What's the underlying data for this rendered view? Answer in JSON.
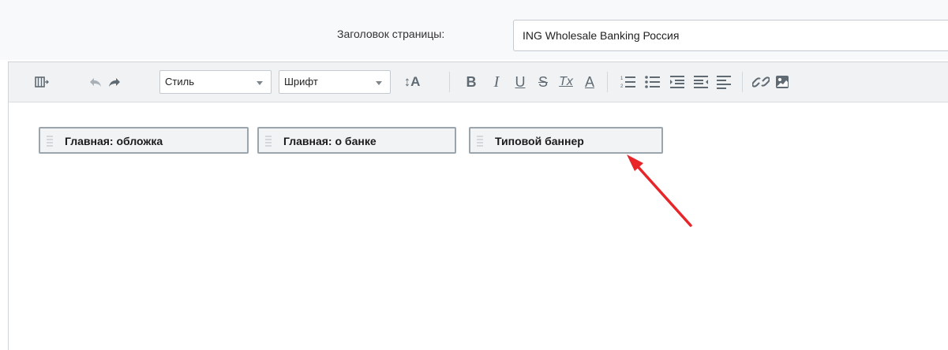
{
  "title_row": {
    "label": "Заголовок страницы:",
    "value": "ING Wholesale Banking Россия"
  },
  "toolbar": {
    "style_select": "Стиль",
    "font_select": "Шрифт",
    "font_size_icon": "↕A",
    "bold": "B",
    "italic": "I",
    "underline": "U",
    "strikethrough": "S",
    "remove_format": "Tx",
    "font_color": "A",
    "icons": [
      "source-view-icon",
      "undo-icon",
      "redo-icon",
      "font-size-icon",
      "bold-icon",
      "italic-icon",
      "underline-icon",
      "strikethrough-icon",
      "remove-format-icon",
      "font-color-icon",
      "ordered-list-icon",
      "unordered-list-icon",
      "indent-icon",
      "outdent-icon",
      "align-left-icon",
      "link-icon",
      "image-icon"
    ]
  },
  "blocks": [
    {
      "label": "Главная: обложка"
    },
    {
      "label": "Главная: о банке"
    },
    {
      "label": "Типовой баннер"
    }
  ],
  "colors": {
    "arrow": "#e8262a",
    "toolbar_bg": "#f0f2f3",
    "title_row_bg": "#f7f9fa",
    "block_border": "#9ba5ad"
  }
}
